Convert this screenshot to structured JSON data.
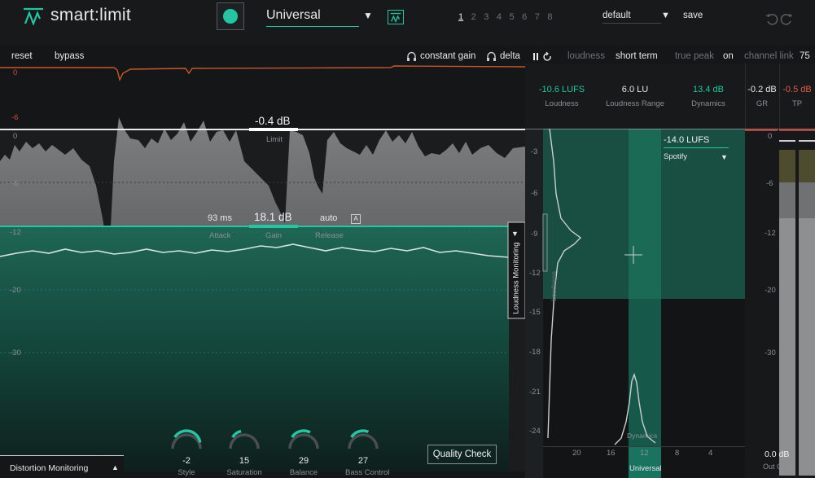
{
  "header": {
    "app_title": "smart:limit",
    "profile": "Universal",
    "presets": [
      "1",
      "2",
      "3",
      "4",
      "5",
      "6",
      "7",
      "8"
    ],
    "preset_name": "default",
    "save_label": "save"
  },
  "toolbar": {
    "reset": "reset",
    "bypass": "bypass",
    "constant_gain": "constant gain",
    "delta": "delta",
    "loudness": "loudness",
    "short_term": "short term",
    "true_peak": "true peak",
    "true_peak_state": "on",
    "channel_link": "channel link",
    "channel_link_value": "75"
  },
  "gr_scale": {
    "top": "0",
    "mid": "-6"
  },
  "main_scale": [
    "0",
    "-6",
    "-12",
    "-20",
    "-30"
  ],
  "limit": {
    "value": "-0.4 dB",
    "label": "Limit"
  },
  "gain": {
    "attack_value": "93 ms",
    "attack_label": "Attack",
    "value": "18.1 dB",
    "label": "Gain",
    "release_value": "auto",
    "release_label": "Release",
    "auto_badge": "A"
  },
  "loudness_monitoring": "Loudness Monitoring",
  "distortion_monitoring": "Distortion Monitoring",
  "knobs": [
    {
      "value": "-2",
      "label": "Style",
      "level": 0.47
    },
    {
      "value": "15",
      "label": "Saturation",
      "level": 0.15
    },
    {
      "value": "29",
      "label": "Balance",
      "level": 0.29
    },
    {
      "value": "27",
      "label": "Bass Control",
      "level": 0.27
    }
  ],
  "quality_check": "Quality Check",
  "stats": {
    "loudness_value": "-10.6 LUFS",
    "loudness_label": "Loudness",
    "range_value": "6.0 LU",
    "range_label": "Loudness Range",
    "dynamics_value": "13.4 dB",
    "dynamics_label": "Dynamics",
    "gr_value": "-0.2 dB",
    "gr_label": "GR",
    "tp_value": "-0.5 dB",
    "tp_label": "TP"
  },
  "target": {
    "value": "-14.0 LUFS",
    "platform": "Spotify"
  },
  "loudness_axis": [
    "-3",
    "-6",
    "-9",
    "-12",
    "-15",
    "-18",
    "-21",
    "-24"
  ],
  "loudness_axis_label": "Loudness",
  "dynamics_axis": [
    "20",
    "16",
    "12",
    "8",
    "4"
  ],
  "dynamics_axis_label": "Dynamics",
  "genre_label": "Universal",
  "meter_scale": [
    "0",
    "-6",
    "-12",
    "-20",
    "-30"
  ],
  "out_gain": {
    "value": "0.0 dB",
    "label": "Out Gain"
  },
  "colors": {
    "accent": "#22c7a1",
    "red": "#e05a4a",
    "orange": "#c8572f"
  }
}
